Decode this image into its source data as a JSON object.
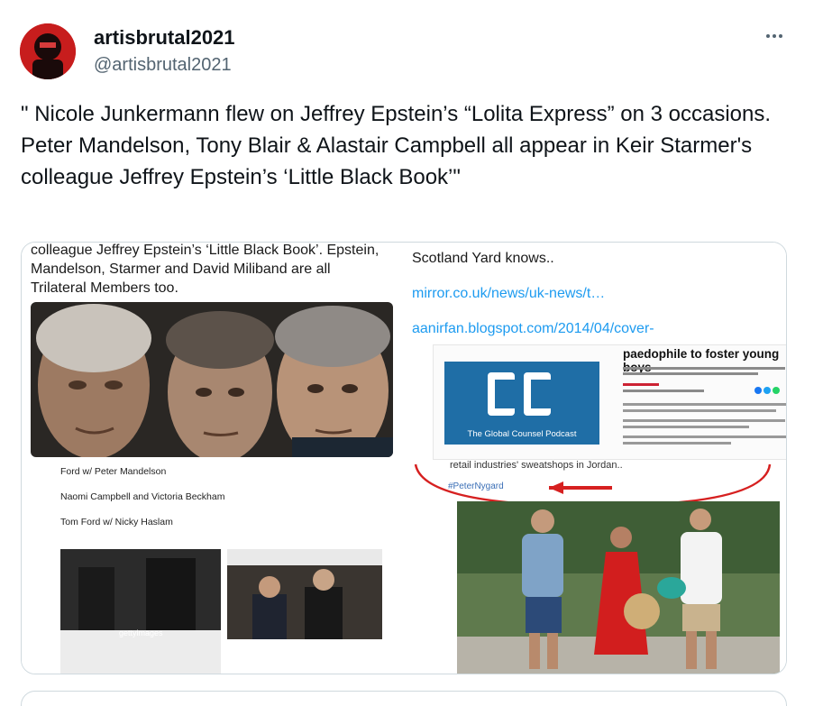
{
  "author": {
    "name": "artisbrutal2021",
    "handle": "@artisbrutal2021"
  },
  "more_icon": "more-horizontal-icon",
  "tweet": {
    "text": "\" Nicole Junkermann flew on Jeffrey Epstein’s “Lolita Express” on 3 occasions. Peter Mandelson, Tony Blair & Alastair Campbell all appear in Keir Starmer's colleague Jeffrey Epstein’s ‘Little Black Book’\""
  },
  "media": {
    "left": {
      "text_lines": [
        "colleague Jeffrey Epstein’s ‘Little Black Book’. Epstein,",
        "Mandelson, Starmer and David Miliband are all",
        "Trilateral Members too."
      ],
      "captions": [
        "Ford w/ Peter Mandelson",
        "Naomi Campbell and Victoria Beckham",
        "Tom Ford w/ Nicky Haslam"
      ],
      "getty_label": "gettyimages"
    },
    "right": {
      "text_line": "Scotland Yard knows..",
      "links": [
        "mirror.co.uk/news/uk-news/t…",
        "aanirfan.blogspot.com/2014/04/cover-"
      ],
      "article_headline": "paedophile to foster young boys",
      "podcast_title": "The Global Counsel Podcast",
      "retail_text": "retail industries' sweatshops in Jordan..",
      "hashtag": "#PeterNygard"
    }
  },
  "colors": {
    "link": "#1d9bf0",
    "text": "#0f1419",
    "secondary": "#536471",
    "border": "#cfd9de",
    "annotation_red": "#d62020"
  }
}
